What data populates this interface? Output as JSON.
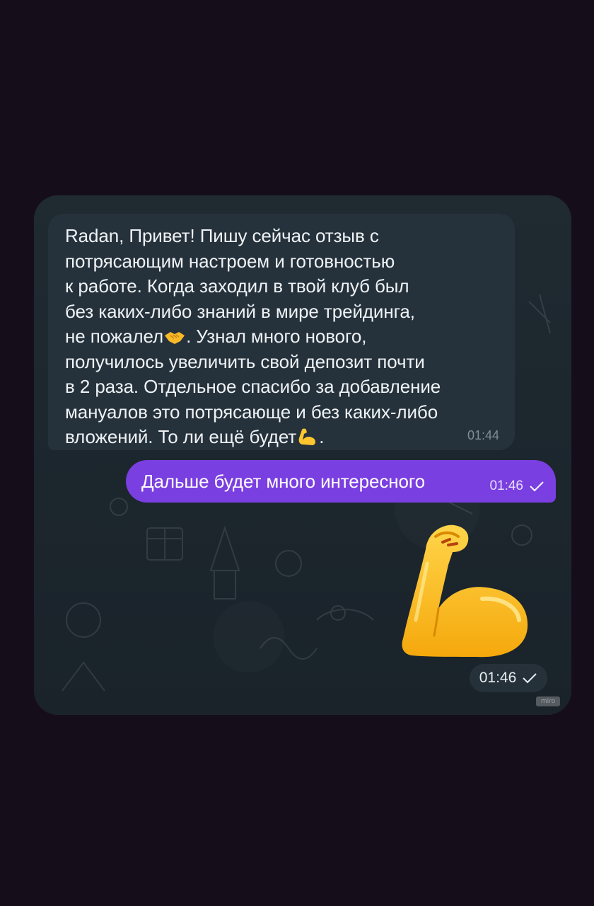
{
  "incoming_message": {
    "part1": "Radan, Привет! Пишу сейчас отзыв с\nпотрясающим настроем и готовностью\nк работе. Когда заходил в твой клуб был\nбез каких-либо знаний в мире трейдинга,\nне пожалел",
    "emoji1": "handshake-emoji",
    "part2": ". Узнал много нового,\nполучилось увеличить свой депозит почти\nв 2 раза. Отдельное спасибо за добавление\nмануалов это потрясающе и без каких-либо\nвложений. То ли ещё будет",
    "emoji2": "flexed-biceps-emoji",
    "part3": ".",
    "time": "01:44"
  },
  "outgoing_message": {
    "text": "Дальше будет много интересного",
    "time": "01:46",
    "status_icon": "check-icon"
  },
  "sticker_message": {
    "sticker": "flexed-biceps-sticker",
    "time": "01:46",
    "status_icon": "check-icon"
  },
  "watermark": {
    "text": "miro"
  },
  "colors": {
    "page_background": "#160d1b",
    "chat_background": "#1c262e",
    "incoming_bubble": "#26323b",
    "outgoing_bubble": "#7a3fe0",
    "sticker_yellow": "#ffc52e"
  }
}
